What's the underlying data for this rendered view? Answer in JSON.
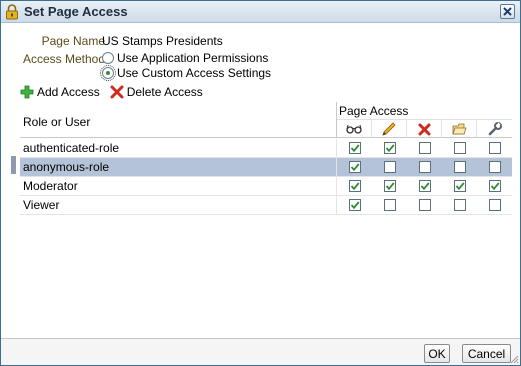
{
  "dialog": {
    "title": "Set Page Access",
    "icons": {
      "title": "lock-icon",
      "close": "close-icon"
    }
  },
  "form": {
    "page_name_label": "Page Name",
    "page_name_value": "US Stamps Presidents",
    "access_method_label": "Access Method",
    "options": [
      {
        "label": "Use Application Permissions",
        "checked": false
      },
      {
        "label": "Use Custom Access Settings",
        "checked": true
      }
    ]
  },
  "toolbar": {
    "add_label": "Add Access",
    "add_icon": "plus-icon",
    "delete_label": "Delete Access",
    "delete_icon": "delete-x-icon"
  },
  "table": {
    "role_header": "Role or User",
    "access_header": "Page Access",
    "permission_icons": [
      "view-glasses-icon",
      "edit-pencil-icon",
      "delete-x-icon",
      "folder-icon",
      "wrench-icon"
    ],
    "rows": [
      {
        "role": "authenticated-role",
        "perms": [
          true,
          true,
          false,
          false,
          false
        ],
        "selected": false
      },
      {
        "role": "anonymous-role",
        "perms": [
          true,
          false,
          false,
          false,
          false
        ],
        "selected": true
      },
      {
        "role": "Moderator",
        "perms": [
          true,
          true,
          true,
          true,
          true
        ],
        "selected": false
      },
      {
        "role": "Viewer",
        "perms": [
          true,
          false,
          false,
          false,
          false
        ],
        "selected": false
      }
    ]
  },
  "buttons": {
    "ok": "OK",
    "cancel": "Cancel"
  },
  "colors": {
    "selected_row": "#b5c3d8",
    "check_green": "#2e8b2e",
    "accent_border": "#3f6e93"
  }
}
